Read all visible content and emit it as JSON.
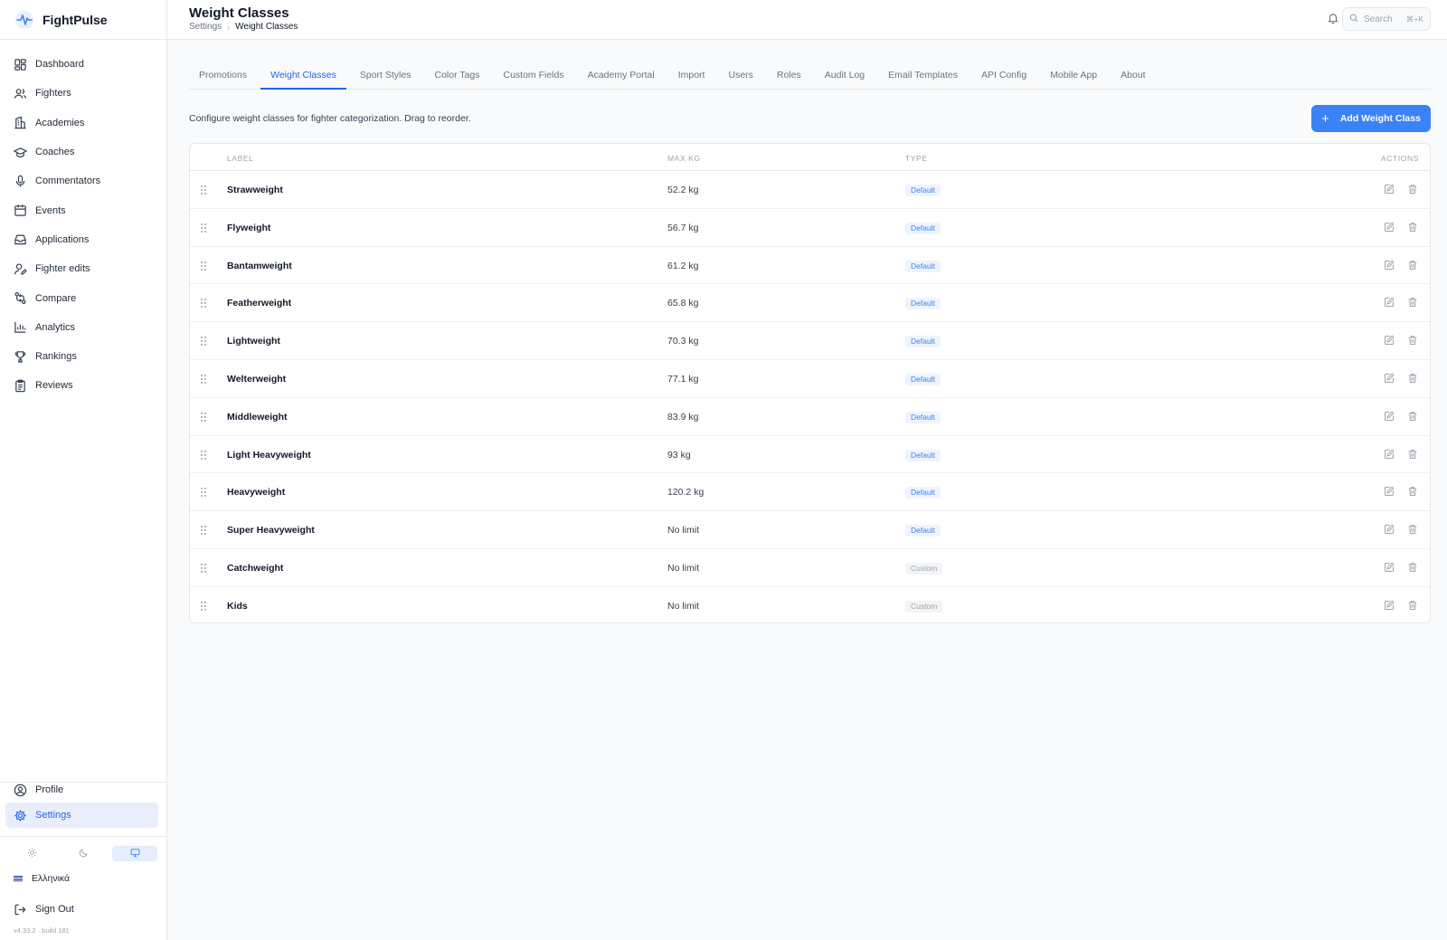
{
  "app": {
    "name": "FightPulse"
  },
  "sidebar": {
    "items": [
      {
        "label": "Dashboard",
        "icon": "dashboard-icon"
      },
      {
        "label": "Fighters",
        "icon": "users-icon"
      },
      {
        "label": "Academies",
        "icon": "building-icon"
      },
      {
        "label": "Coaches",
        "icon": "graduation-cap-icon"
      },
      {
        "label": "Commentators",
        "icon": "microphone-icon"
      },
      {
        "label": "Events",
        "icon": "calendar-icon"
      },
      {
        "label": "Applications",
        "icon": "inbox-icon"
      },
      {
        "label": "Fighter edits",
        "icon": "user-edit-icon"
      },
      {
        "label": "Compare",
        "icon": "compare-icon"
      },
      {
        "label": "Analytics",
        "icon": "bar-chart-icon"
      },
      {
        "label": "Rankings",
        "icon": "trophy-icon"
      },
      {
        "label": "Reviews",
        "icon": "clipboard-icon"
      }
    ],
    "profile_label": "Profile",
    "settings_label": "Settings",
    "language_label": "Ελληνικά",
    "signout_label": "Sign Out",
    "version": "v4.33.2 · build 181"
  },
  "header": {
    "title": "Weight Classes",
    "breadcrumb": [
      "Settings",
      "Weight Classes"
    ],
    "search_placeholder": "Search",
    "search_shortcut": "⌘+K"
  },
  "tabs": [
    "Promotions",
    "Weight Classes",
    "Sport Styles",
    "Color Tags",
    "Custom Fields",
    "Academy Portal",
    "Import",
    "Users",
    "Roles",
    "Audit Log",
    "Email Templates",
    "API Config",
    "Mobile App",
    "About"
  ],
  "active_tab": "Weight Classes",
  "description": "Configure weight classes for fighter categorization. Drag to reorder.",
  "add_button_label": "Add Weight Class",
  "table": {
    "headers": {
      "label": "LABEL",
      "max": "MAX KG",
      "type": "TYPE",
      "actions": "ACTIONS"
    },
    "rows": [
      {
        "label": "Strawweight",
        "max": "52.2 kg",
        "type": "Default"
      },
      {
        "label": "Flyweight",
        "max": "56.7 kg",
        "type": "Default"
      },
      {
        "label": "Bantamweight",
        "max": "61.2 kg",
        "type": "Default"
      },
      {
        "label": "Featherweight",
        "max": "65.8 kg",
        "type": "Default"
      },
      {
        "label": "Lightweight",
        "max": "70.3 kg",
        "type": "Default"
      },
      {
        "label": "Welterweight",
        "max": "77.1 kg",
        "type": "Default"
      },
      {
        "label": "Middleweight",
        "max": "83.9 kg",
        "type": "Default"
      },
      {
        "label": "Light Heavyweight",
        "max": "93 kg",
        "type": "Default"
      },
      {
        "label": "Heavyweight",
        "max": "120.2 kg",
        "type": "Default"
      },
      {
        "label": "Super Heavyweight",
        "max": "No limit",
        "type": "Default"
      },
      {
        "label": "Catchweight",
        "max": "No limit",
        "type": "Custom"
      },
      {
        "label": "Kids",
        "max": "No limit",
        "type": "Custom"
      }
    ]
  },
  "colors": {
    "accent": "#3b82f6",
    "accent_dark": "#2563eb"
  }
}
